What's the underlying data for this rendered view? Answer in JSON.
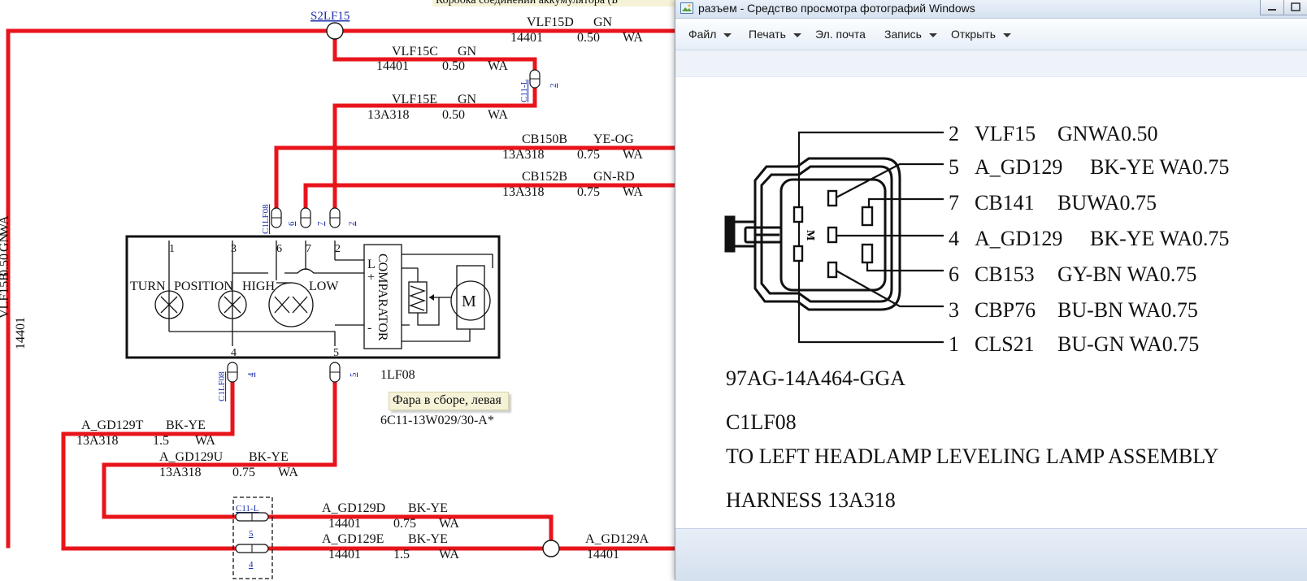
{
  "diagram": {
    "top_cut_text": "Коробка соединений аккумулятора (Б",
    "splice": "S2LF15",
    "wires": [
      {
        "code": "VLF15D",
        "color": "GN",
        "part": "14401",
        "size": "0.50",
        "ins": "WA"
      },
      {
        "code": "VLF15C",
        "color": "GN",
        "part": "14401",
        "size": "0.50",
        "ins": "WA"
      },
      {
        "code": "VLF15E",
        "color": "GN",
        "part": "13A318",
        "size": "0.50",
        "ins": "WA"
      },
      {
        "code": "CB150B",
        "color": "YE-OG",
        "part": "13A318",
        "size": "0.75",
        "ins": "WA"
      },
      {
        "code": "CB152B",
        "color": "GN-RD",
        "part": "13A318",
        "size": "0.75",
        "ins": "WA"
      },
      {
        "code": "A_GD129T",
        "color": "BK-YE",
        "part": "13A318",
        "size": "1.5",
        "ins": "WA"
      },
      {
        "code": "A_GD129U",
        "color": "BK-YE",
        "part": "13A318",
        "size": "0.75",
        "ins": "WA"
      },
      {
        "code": "A_GD129D",
        "color": "BK-YE",
        "part": "14401",
        "size": "0.75",
        "ins": "WA"
      },
      {
        "code": "A_GD129E",
        "color": "BK-YE",
        "part": "14401",
        "size": "1.5",
        "ins": "WA"
      },
      {
        "code": "A_GD129A",
        "part": "14401"
      }
    ],
    "vertical_wire": {
      "code": "VLF15B",
      "color": "GN",
      "size": "0.50",
      "ins": "WA",
      "part": "14401"
    },
    "connector_c11l": "C11-L",
    "connector_c1lf08": "C1LF08",
    "pins": {
      "p2": "2",
      "p4": "4",
      "p5": "5",
      "p6": "6",
      "p7": "7"
    },
    "box_pins": [
      "1",
      "3",
      "6",
      "7",
      "2"
    ],
    "box_labels": {
      "turn": "TURN",
      "position": "POSITION",
      "high": "HIGH",
      "low": "LOW",
      "comparator": "COMPARATOR",
      "motor": "M",
      "l_plus": "L",
      "plus": "+",
      "minus": "-"
    },
    "component_id": "1LF08",
    "component_tooltip": "Фара в сборе, левая",
    "component_part": "6C11-13W029/30-A*"
  },
  "viewer": {
    "title": "разъем - Средство просмотра фотографий Windows",
    "menu": [
      {
        "label": "Файл",
        "has_arrow": true
      },
      {
        "label": "Печать",
        "has_arrow": true
      },
      {
        "label": "Эл. почта",
        "has_arrow": false
      },
      {
        "label": "Запись",
        "has_arrow": true
      },
      {
        "label": "Открыть",
        "has_arrow": true
      }
    ],
    "pinout": [
      {
        "pin": "2",
        "circuit": "VLF15",
        "spec": "GNWA0.50"
      },
      {
        "pin": "5",
        "circuit": "A_GD129",
        "spec": "BK-YE   WA0.75"
      },
      {
        "pin": "7",
        "circuit": "CB141",
        "spec": "BUWA0.75"
      },
      {
        "pin": "4",
        "circuit": "A_GD129",
        "spec": "BK-YE   WA0.75"
      },
      {
        "pin": "6",
        "circuit": "CB153",
        "spec": "GY-BN   WA0.75"
      },
      {
        "pin": "3",
        "circuit": "CBP76",
        "spec": "BU-BN   WA0.75"
      },
      {
        "pin": "1",
        "circuit": "CLS21",
        "spec": "BU-GN   WA0.75"
      }
    ],
    "connector_face_letter": "M",
    "part_number": "97AG-14A464-GGA",
    "connector_name": "C1LF08",
    "description": "TO LEFT HEADLAMP LEVELING LAMP ASSEMBLY",
    "harness": "HARNESS 13A318"
  }
}
